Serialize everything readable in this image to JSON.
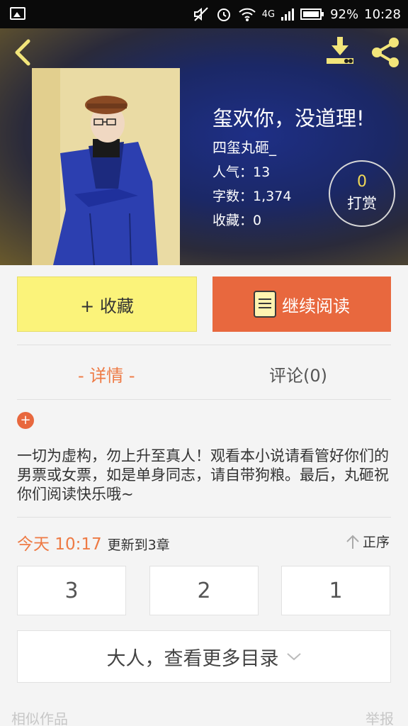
{
  "status_bar": {
    "network": "4G",
    "battery": "92%",
    "time": "10:28"
  },
  "book": {
    "title": "玺欢你，没道理!",
    "author": "四玺丸砸_",
    "popularity_label": "人气：",
    "popularity_value": "13",
    "words_label": "字数：",
    "words_value": "1,374",
    "collections_label": "收藏：",
    "collections_value": "0"
  },
  "reward": {
    "count": "0",
    "label": "打赏"
  },
  "buttons": {
    "collect": "+ 收藏",
    "continue_reading": "继续阅读"
  },
  "tabs": {
    "detail": "- 详情 -",
    "comments": "评论(0)"
  },
  "plus_icon": "+",
  "description": "一切为虚构，勿上升至真人！观看本小说请看管好你们的男票或女票，如是单身同志，请自带狗粮。最后，丸砸祝你们阅读快乐哦~",
  "update": {
    "time": "今天 10:17",
    "info": "更新到3章",
    "order_label": "正序"
  },
  "chapters": [
    "3",
    "2",
    "1"
  ],
  "more_catalog": "大人，查看更多目录",
  "footer": {
    "similar": "相似作品",
    "report": "举报"
  },
  "colors": {
    "accent_orange": "#e8683e",
    "collect_yellow": "#fbf37a",
    "reward_yellow": "#f2da57",
    "header_blue": "#1e2f86"
  },
  "icons": [
    "back-icon",
    "download-icon",
    "share-icon",
    "image-icon",
    "mute-icon",
    "alarm-icon",
    "wifi-icon",
    "signal-icon",
    "battery-icon",
    "book-icon",
    "sort-arrow-icon",
    "chevron-down-icon"
  ]
}
